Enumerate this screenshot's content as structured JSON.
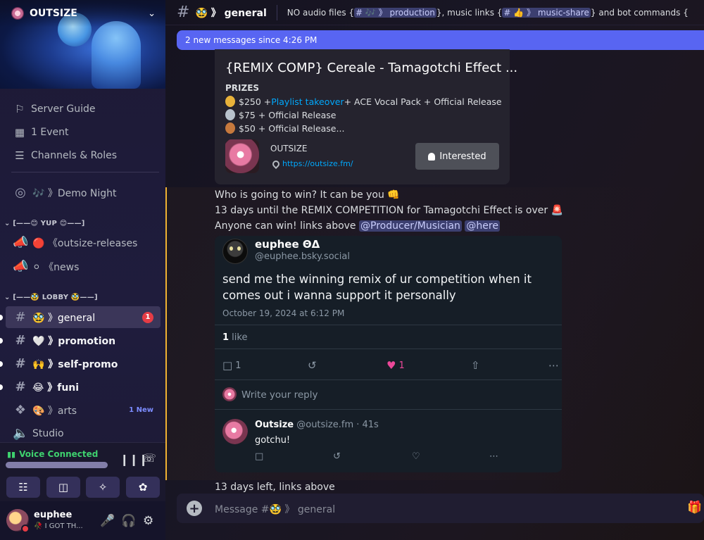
{
  "server": {
    "name": "OUTSIZE",
    "menu_items": [
      {
        "icon": "signpost-icon",
        "label": "Server Guide"
      },
      {
        "icon": "calendar-icon",
        "label": "1 Event"
      },
      {
        "icon": "channels-roles-icon",
        "label": "Channels & Roles"
      }
    ]
  },
  "sidebar": {
    "stage_channel": {
      "icon": "stage-icon",
      "label": "🎶 》Demo Night"
    },
    "categories": [
      {
        "label": "[——😊 YUP 😊——]"
      },
      {
        "label": "[——🥸 LOBBY 🥸——]"
      }
    ],
    "channels": [
      {
        "icon": "megaphone-icon",
        "label": "🔴 《outsize-releases"
      },
      {
        "icon": "megaphone-icon",
        "label": "⚪ 《news"
      },
      {
        "icon": "hash-icon",
        "label": "🥸 》general",
        "badge": "1"
      },
      {
        "icon": "hash-icon",
        "label": "🤍 》promotion"
      },
      {
        "icon": "hash-icon",
        "label": "🙌 》self-promo"
      },
      {
        "icon": "hash-icon",
        "label": "😂 》funi"
      },
      {
        "icon": "forum-icon",
        "label": "🎨 》arts",
        "new_label": "1 New"
      },
      {
        "icon": "speaker-icon",
        "label": "Studio"
      }
    ]
  },
  "voice": {
    "status": "Voice Connected"
  },
  "user": {
    "name": "euphee",
    "status": "🥀 I GOT TH..."
  },
  "channel_header": {
    "title": "🥸 》 general",
    "topic_parts": [
      "NO audio files {",
      "# 🎶 》 production",
      "}, music links {",
      "# 👍 》 music-share",
      "} and bot commands {",
      "# ..."
    ]
  },
  "banner": {
    "new_messages": "2 new messages since 4:26 PM"
  },
  "event_card": {
    "title": "{REMIX COMP} Cereale - Tamagotchi Effect ...",
    "prizes_heading": "PRIZES",
    "prize_1_amount": "$250 + ",
    "prize_1_link": "Playlist takeover",
    "prize_1_rest": " + ACE Vocal Pack + Official Release",
    "prize_2": "$75 + Official Release",
    "prize_3": "$50 + Official Release...",
    "organizer": "OUTSIZE",
    "website": "https://outsize.fm/",
    "interested_label": "Interested"
  },
  "messages": {
    "line1": "Who is going to win? It can be you 👊",
    "line2": "13 days until the REMIX COMPETITION for Tamagotchi Effect is over 🚨",
    "line3_text": "Anyone can win! links above ",
    "mention_role": "@Producer/Musician",
    "mention_here": "@here",
    "bottom": "13 days left, links above"
  },
  "bsky_embed": {
    "author_name": "euphee ΘΔ",
    "author_handle": "@euphee.bsky.social",
    "text": "send me the winning remix of ur competition when it comes out i wanna support it personally",
    "date": "October 19, 2024 at 6:12 PM",
    "likes_count": "1",
    "likes_word": " like",
    "reply_count": "1",
    "heart_count": "1",
    "reply_placeholder": "Write your reply",
    "reply_author": "Outsize",
    "reply_meta": " @outsize.fm · 41s",
    "reply_text": "gotchu!"
  },
  "composer": {
    "placeholder": "Message #🥸 》 general"
  },
  "colors": {
    "accent": "#5865f2",
    "unread_red": "#e63c45",
    "voice_green": "#3ed16e",
    "link": "#00a8fc",
    "heart": "#ec4899"
  }
}
